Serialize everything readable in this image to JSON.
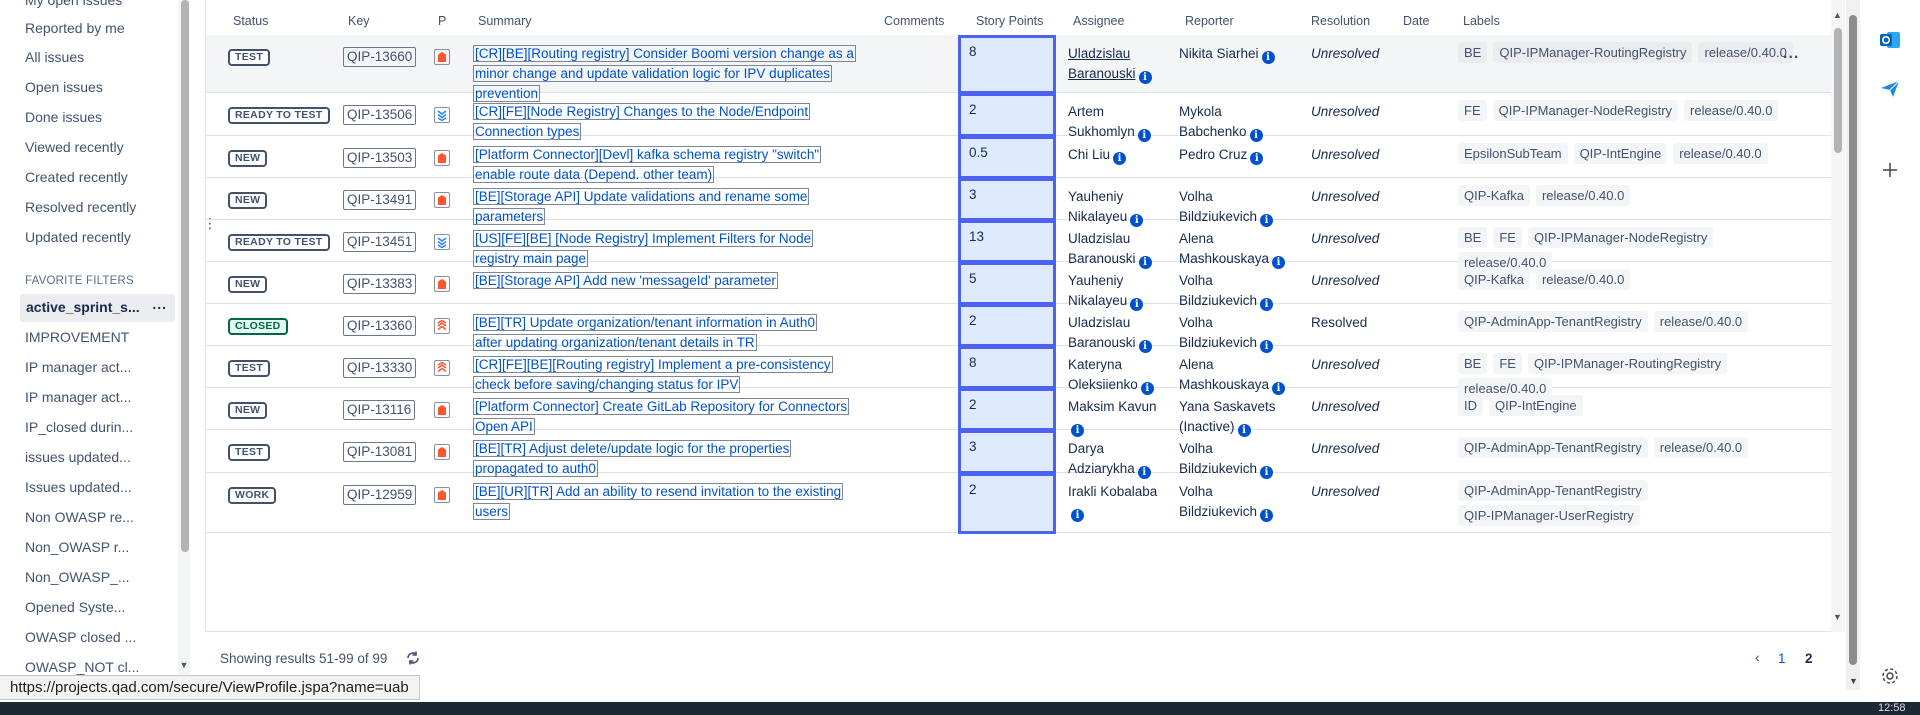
{
  "sidebar": {
    "nav_items": [
      "My open issues",
      "Reported by me",
      "All issues",
      "Open issues",
      "Done issues",
      "Viewed recently",
      "Created recently",
      "Resolved recently",
      "Updated recently"
    ],
    "favorites_title": "FAVORITE FILTERS",
    "favorites": [
      "active_sprint_s...",
      "IMPROVEMENT",
      "IP manager act...",
      "IP manager act...",
      "IP_closed durin...",
      "issues updated...",
      "Issues updated...",
      "Non OWASP re...",
      "Non_OWASP r...",
      "Non_OWASP_...",
      "Opened Syste...",
      "OWASP closed ...",
      "OWASP_NOT cl..."
    ],
    "active_more": "..."
  },
  "table": {
    "headers": {
      "status": "Status",
      "key": "Key",
      "priority": "P",
      "summary": "Summary",
      "comments": "Comments",
      "story_points": "Story Points",
      "assignee": "Assignee",
      "reporter": "Reporter",
      "resolution": "Resolution",
      "date": "Date",
      "labels": "Labels"
    },
    "rows": [
      {
        "status": "TEST",
        "key": "QIP-13660",
        "priority_icon": "highest-priority-icon",
        "summary": [
          "[CR][BE][Routing registry] Consider Boomi version change as a",
          "minor change and update validation logic for IPV duplicates",
          "prevention"
        ],
        "story_points": "8",
        "assignee": [
          "Uladzislau",
          "Baranouski"
        ],
        "reporter": [
          "Nikita Siarhei"
        ],
        "resolution": "Unresolved",
        "labels": [
          "BE",
          "QIP-IPManager-RoutingRegistry",
          "release/0.40.0"
        ]
      },
      {
        "status": "READY TO TEST",
        "key": "QIP-13506",
        "priority_icon": "lowest-priority-icon",
        "summary": [
          "[CR][FE][Node Registry] Changes to the Node/Endpoint",
          "Connection types"
        ],
        "story_points": "2",
        "assignee": [
          "Artem",
          "Sukhomlyn"
        ],
        "reporter": [
          "Mykola",
          "Babchenko"
        ],
        "resolution": "Unresolved",
        "labels": [
          "FE",
          "QIP-IPManager-NodeRegistry",
          "release/0.40.0"
        ]
      },
      {
        "status": "NEW",
        "key": "QIP-13503",
        "priority_icon": "highest-priority-icon",
        "summary": [
          "[Platform Connector][Devl] kafka schema registry \"switch\"",
          "enable route data (Depend. other team)"
        ],
        "story_points": "0.5",
        "assignee": [
          "Chi Liu"
        ],
        "reporter": [
          "Pedro Cruz"
        ],
        "resolution": "Unresolved",
        "labels": [
          "EpsilonSubTeam",
          "QIP-IntEngine",
          "release/0.40.0"
        ]
      },
      {
        "status": "NEW",
        "key": "QIP-13491",
        "priority_icon": "highest-priority-icon",
        "summary": [
          "[BE][Storage API] Update validations and rename some",
          "parameters"
        ],
        "story_points": "3",
        "assignee": [
          "Yauheniy",
          "Nikalayeu"
        ],
        "reporter": [
          "Volha",
          "Bildziukevich"
        ],
        "resolution": "Unresolved",
        "labels": [
          "QIP-Kafka",
          "release/0.40.0"
        ]
      },
      {
        "status": "READY TO TEST",
        "key": "QIP-13451",
        "priority_icon": "lowest-priority-icon",
        "summary": [
          "[US][FE][BE] [Node Registry] Implement Filters for Node",
          "registry main page"
        ],
        "story_points": "13",
        "assignee": [
          "Uladzislau",
          "Baranouski"
        ],
        "reporter": [
          "Alena",
          "Mashkouskaya"
        ],
        "resolution": "Unresolved",
        "labels": [
          "BE",
          "FE",
          "QIP-IPManager-NodeRegistry",
          "release/0.40.0"
        ]
      },
      {
        "status": "NEW",
        "key": "QIP-13383",
        "priority_icon": "highest-priority-icon",
        "summary": [
          "[BE][Storage API] Add new 'messageId' parameter"
        ],
        "story_points": "5",
        "assignee": [
          "Yauheniy",
          "Nikalayeu"
        ],
        "reporter": [
          "Volha",
          "Bildziukevich"
        ],
        "resolution": "Unresolved",
        "labels": [
          "QIP-Kafka",
          "release/0.40.0"
        ]
      },
      {
        "status": "CLOSED",
        "key": "QIP-13360",
        "priority_icon": "high-priority-icon",
        "summary": [
          "[BE][TR] Update organization/tenant information in Auth0",
          "after updating organization/tenant details in TR"
        ],
        "story_points": "2",
        "assignee": [
          "Uladzislau",
          "Baranouski"
        ],
        "reporter": [
          "Volha",
          "Bildziukevich"
        ],
        "resolution": "Resolved",
        "labels": [
          "QIP-AdminApp-TenantRegistry",
          "release/0.40.0"
        ]
      },
      {
        "status": "TEST",
        "key": "QIP-13330",
        "priority_icon": "high-priority-icon",
        "summary": [
          "[CR][FE][BE][Routing registry] Implement a pre-consistency",
          "check before saving/changing status for IPV"
        ],
        "story_points": "8",
        "assignee": [
          "Kateryna",
          "Oleksiienko"
        ],
        "reporter": [
          "Alena",
          "Mashkouskaya"
        ],
        "resolution": "Unresolved",
        "labels": [
          "BE",
          "FE",
          "QIP-IPManager-RoutingRegistry",
          "release/0.40.0"
        ]
      },
      {
        "status": "NEW",
        "key": "QIP-13116",
        "priority_icon": "highest-priority-icon",
        "summary": [
          "[Platform Connector] Create GitLab Repository for Connectors",
          "Open API"
        ],
        "story_points": "2",
        "assignee": [
          "Maksim Kavun"
        ],
        "reporter": [
          "Yana Saskavets",
          "(Inactive)"
        ],
        "resolution": "Unresolved",
        "labels": [
          "ID",
          "QIP-IntEngine"
        ]
      },
      {
        "status": "TEST",
        "key": "QIP-13081",
        "priority_icon": "highest-priority-icon",
        "summary": [
          "[BE][TR] Adjust delete/update logic for the properties",
          "propagated to auth0"
        ],
        "story_points": "3",
        "assignee": [
          "Darya",
          "Adziarykha"
        ],
        "reporter": [
          "Volha",
          "Bildziukevich"
        ],
        "resolution": "Unresolved",
        "labels": [
          "QIP-AdminApp-TenantRegistry",
          "release/0.40.0"
        ]
      },
      {
        "status": "WORK",
        "key": "QIP-12959",
        "priority_icon": "highest-priority-icon",
        "summary": [
          "[BE][UR][TR] Add an ability to resend invitation to the existing",
          "users"
        ],
        "story_points": "2",
        "assignee": [
          "Irakli Kobalaba"
        ],
        "reporter": [
          "Volha",
          "Bildziukevich"
        ],
        "resolution": "Unresolved",
        "labels": [
          "QIP-AdminApp-TenantRegistry",
          "QIP-IPManager-UserRegistry"
        ]
      }
    ],
    "row_actions": "..."
  },
  "footer": {
    "results_text": "Showing results 51-99 of 99",
    "pages": [
      "1",
      "2"
    ],
    "current_page": "2"
  },
  "status_url": "https://projects.qad.com/secure/ViewProfile.jspa?name=uab",
  "clock": "12:58",
  "colors": {
    "link": "#0052cc",
    "story_points_bg": "#deebff",
    "story_points_border": "#4c63f2",
    "priority_high": "#ff5630",
    "priority_low": "#2684ff",
    "closed": "#006644"
  }
}
